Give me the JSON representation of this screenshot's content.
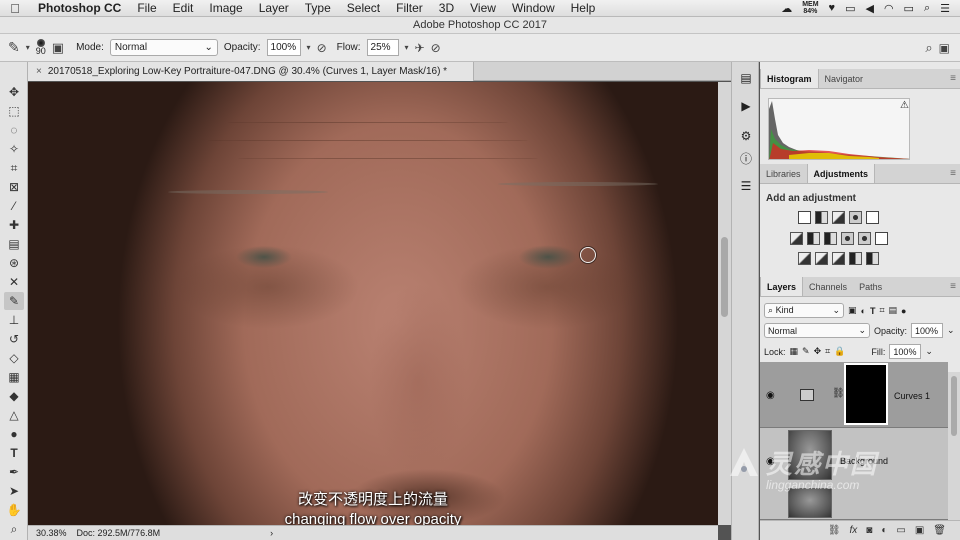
{
  "menubar": {
    "app": "Photoshop CC",
    "items": [
      "File",
      "Edit",
      "Image",
      "Layer",
      "Type",
      "Select",
      "Filter",
      "3D",
      "View",
      "Window",
      "Help"
    ],
    "mem_label": "MEM",
    "mem_value": "84%"
  },
  "window": {
    "title": "Adobe Photoshop CC 2017"
  },
  "options": {
    "brush_size": "90",
    "mode_label": "Mode:",
    "mode_value": "Normal",
    "opacity_label": "Opacity:",
    "opacity_value": "100%",
    "flow_label": "Flow:",
    "flow_value": "25%"
  },
  "document": {
    "tab_close": "×",
    "tab_title": "20170518_Exploring Low-Key Portraiture-047.DNG @ 30.4% (Curves 1, Layer Mask/16) *"
  },
  "status": {
    "zoom": "30.38%",
    "doc": "Doc: 292.5M/776.8M",
    "arrow": "›"
  },
  "subtitles": {
    "cn": "改变不透明度上的流量",
    "en": "changing flow over opacity"
  },
  "panels": {
    "top_tabs": [
      "Histogram",
      "Navigator"
    ],
    "mid_tabs": [
      "Libraries",
      "Adjustments"
    ],
    "adjustments_title": "Add an adjustment",
    "layer_tabs": [
      "Layers",
      "Channels",
      "Paths"
    ],
    "kind_label": "Kind",
    "blend_value": "Normal",
    "opacity_label": "Opacity:",
    "opacity_value": "100%",
    "lock_label": "Lock:",
    "fill_label": "Fill:",
    "fill_value": "100%",
    "layers": [
      {
        "name": "Curves 1"
      },
      {
        "name": "Background"
      }
    ]
  },
  "watermark": {
    "cn": "灵感中国",
    "en": "lingganchina.com"
  },
  "colors": {
    "accent": "#c6c6c6",
    "panel_bg": "#e8e8e8",
    "layer_selected": "#9d9d9d"
  }
}
